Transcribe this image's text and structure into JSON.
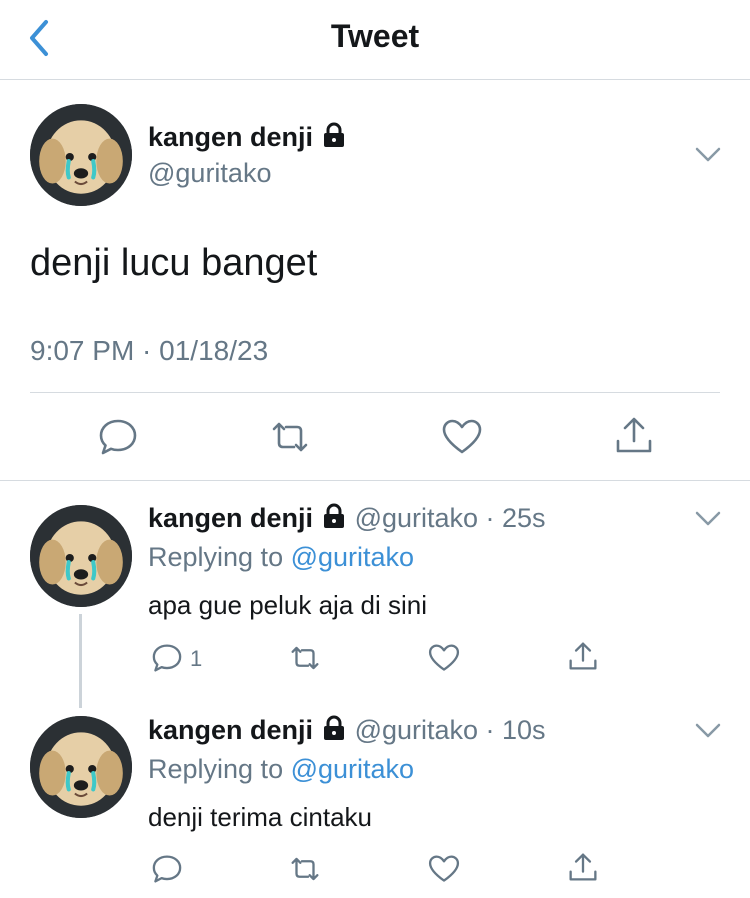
{
  "nav": {
    "title": "Tweet",
    "back_icon": "chevron-left-icon"
  },
  "tweet": {
    "name": "kangen denji",
    "handle": "@guritako",
    "text": "denji lucu banget",
    "timestamp": "9:07 PM · 01/18/23"
  },
  "replies": [
    {
      "name": "kangen denji",
      "handle_time": "@guritako · 25s",
      "replying_prefix": "Replying to",
      "replying_to": "@guritako",
      "text": "apa gue peluk aja di sini",
      "reply_count": "1"
    },
    {
      "name": "kangen denji",
      "handle_time": "@guritako · 10s",
      "replying_prefix": "Replying to",
      "replying_to": "@guritako",
      "text": "denji terima cintaku",
      "reply_count": ""
    }
  ],
  "colors": {
    "accent": "#3c90d6",
    "muted": "#657786",
    "divider": "#d6dbe0"
  }
}
